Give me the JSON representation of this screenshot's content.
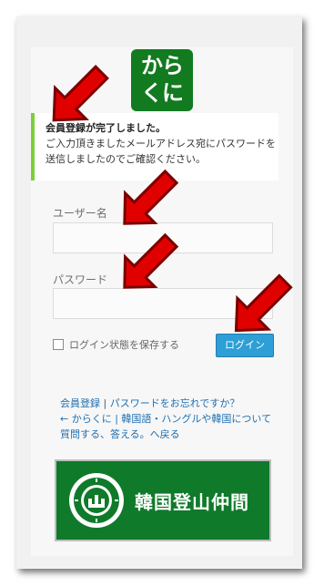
{
  "logo": {
    "line1": "から",
    "line2": "くに",
    "color": "#127a1f"
  },
  "message": {
    "title": "会員登録が完了しました。",
    "line1": "ご入力頂きましたメールアドレス宛にパスワードを",
    "line2": "送信しましたのでご確認ください。"
  },
  "form": {
    "username_label": "ユーザー名",
    "password_label": "パスワード",
    "remember_label": "ログイン状態を保存する",
    "login_button": "ログイン"
  },
  "links": {
    "register": "会員登録",
    "sep": "|",
    "forgot": "パスワードをお忘れですか？",
    "back_line1": "← からくに | 韓国語・ハングルや韓国について",
    "back_line2": "質問する、答える。へ戻る"
  },
  "banner": {
    "text": "韓国登山仲間",
    "color": "#0f7a2a"
  },
  "accent": {
    "arrow": "#e10000",
    "message_border": "#7ad03a",
    "button": "#2e9fd6"
  }
}
